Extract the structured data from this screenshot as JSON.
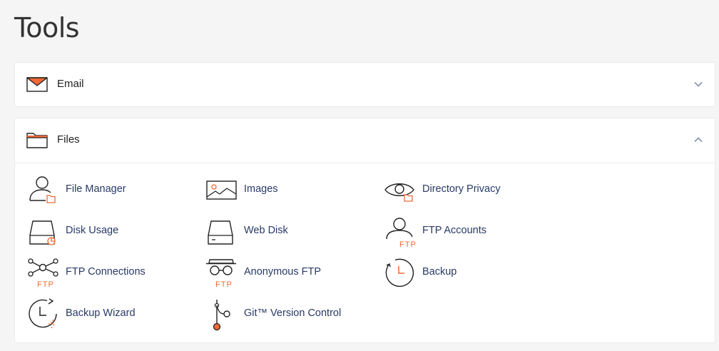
{
  "page": {
    "title": "Tools"
  },
  "sections": {
    "email": {
      "label": "Email",
      "expanded": false,
      "icon": "envelope-icon"
    },
    "files": {
      "label": "Files",
      "expanded": true,
      "icon": "folder-icon"
    }
  },
  "files_tools": [
    {
      "label": "File Manager",
      "icon": "file-manager-icon"
    },
    {
      "label": "Images",
      "icon": "images-icon"
    },
    {
      "label": "Directory Privacy",
      "icon": "directory-privacy-icon"
    },
    {
      "label": "Disk Usage",
      "icon": "disk-usage-icon"
    },
    {
      "label": "Web Disk",
      "icon": "web-disk-icon"
    },
    {
      "label": "FTP Accounts",
      "icon": "ftp-accounts-icon",
      "badge": "FTP"
    },
    {
      "label": "FTP Connections",
      "icon": "ftp-connections-icon",
      "badge": "FTP"
    },
    {
      "label": "Anonymous FTP",
      "icon": "anonymous-ftp-icon",
      "badge": "FTP"
    },
    {
      "label": "Backup",
      "icon": "backup-icon"
    },
    {
      "label": "Backup Wizard",
      "icon": "backup-wizard-icon"
    },
    {
      "label": "Git™ Version Control",
      "icon": "git-icon"
    }
  ],
  "colors": {
    "accent": "#f26a35",
    "icon_stroke": "#222222",
    "link": "#293a67"
  }
}
